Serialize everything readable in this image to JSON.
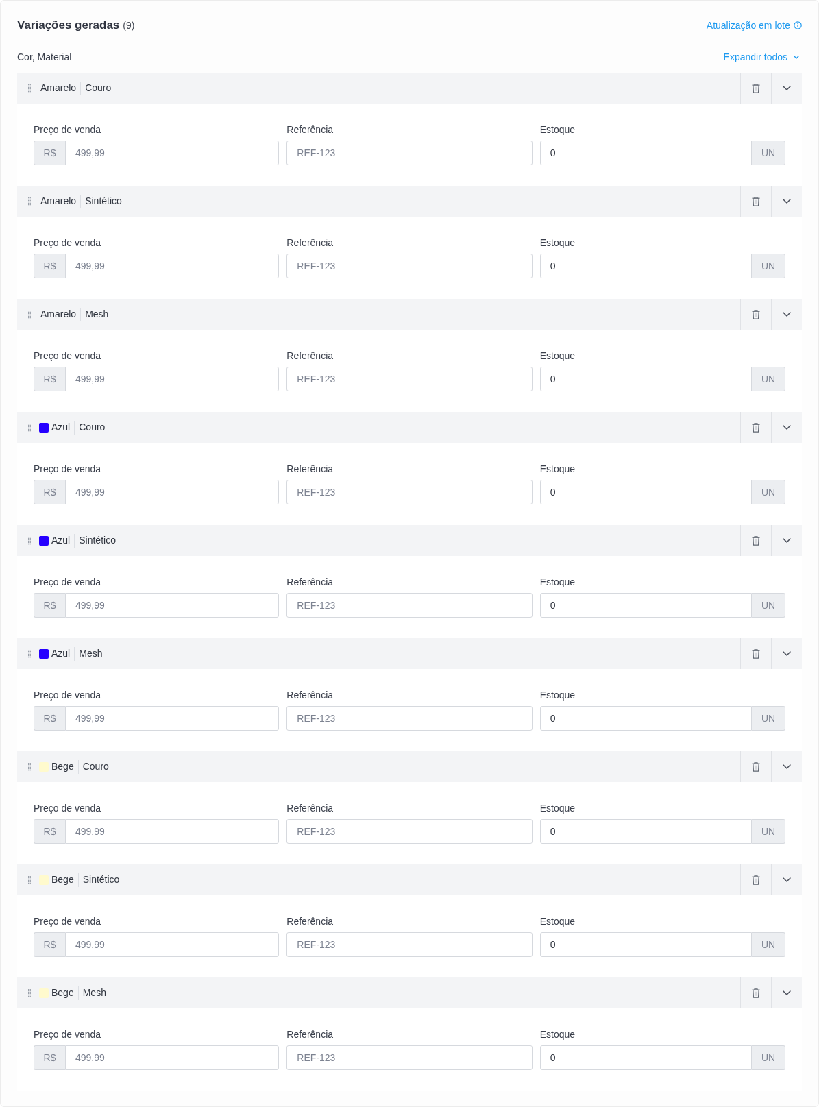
{
  "header": {
    "title": "Variações geradas",
    "count": "(9)",
    "bulk_update": "Atualização em lote"
  },
  "subheader": {
    "attributes": "Cor, Material",
    "expand_all": "Expandir todos"
  },
  "variations": [
    {
      "options": [
        "Amarelo",
        "Couro"
      ],
      "expanded": true,
      "fields": [
        {
          "label": "Preço de venda",
          "prefix": "R$",
          "placeholder": "499,99"
        },
        {
          "label": "Referência",
          "placeholder": "REF-123"
        },
        {
          "label": "Estoque",
          "value": "0",
          "suffix": "UN"
        }
      ]
    },
    {
      "options": [
        "Amarelo",
        "Sintético"
      ],
      "expanded": true,
      "fields": [
        {
          "label": "Preço de venda",
          "prefix": "R$",
          "placeholder": "499,99"
        },
        {
          "label": "Referência",
          "placeholder": "REF-123"
        },
        {
          "label": "Estoque",
          "value": "0",
          "suffix": "UN"
        }
      ]
    },
    {
      "options": [
        "Amarelo",
        "Mesh"
      ],
      "expanded": true,
      "fields": [
        {
          "label": "Preço de venda",
          "prefix": "R$",
          "placeholder": "499,99"
        },
        {
          "label": "Referência",
          "placeholder": "REF-123"
        },
        {
          "label": "Estoque",
          "value": "0",
          "suffix": "UN"
        }
      ]
    },
    {
      "options": [
        "Azul",
        "Couro"
      ],
      "color": "#2600ff",
      "expanded": true,
      "fields": [
        {
          "label": "Preço de venda",
          "prefix": "R$",
          "placeholder": "499,99"
        },
        {
          "label": "Referência",
          "placeholder": "REF-123"
        },
        {
          "label": "Estoque",
          "value": "0",
          "suffix": "UN"
        }
      ]
    },
    {
      "options": [
        "Azul",
        "Sintético"
      ],
      "color": "#2600ff",
      "expanded": true,
      "fields": [
        {
          "label": "Preço de venda",
          "prefix": "R$",
          "placeholder": "499,99"
        },
        {
          "label": "Referência",
          "placeholder": "REF-123"
        },
        {
          "label": "Estoque",
          "value": "0",
          "suffix": "UN"
        }
      ]
    },
    {
      "options": [
        "Azul",
        "Mesh"
      ],
      "color": "#2600ff",
      "expanded": true,
      "fields": [
        {
          "label": "Preço de venda",
          "prefix": "R$",
          "placeholder": "499,99"
        },
        {
          "label": "Referência",
          "placeholder": "REF-123"
        },
        {
          "label": "Estoque",
          "value": "0",
          "suffix": "UN"
        }
      ]
    },
    {
      "options": [
        "Bege",
        "Couro"
      ],
      "color": "#fffacd",
      "expanded": true,
      "fields": [
        {
          "label": "Preço de venda",
          "prefix": "R$",
          "placeholder": "499,99"
        },
        {
          "label": "Referência",
          "placeholder": "REF-123"
        },
        {
          "label": "Estoque",
          "value": "0",
          "suffix": "UN"
        }
      ]
    },
    {
      "options": [
        "Bege",
        "Sintético"
      ],
      "color": "#fffacd",
      "expanded": true,
      "fields": [
        {
          "label": "Preço de venda",
          "prefix": "R$",
          "placeholder": "499,99"
        },
        {
          "label": "Referência",
          "placeholder": "REF-123"
        },
        {
          "label": "Estoque",
          "value": "0",
          "suffix": "UN"
        }
      ]
    },
    {
      "options": [
        "Bege",
        "Mesh"
      ],
      "color": "#fffacd",
      "expanded": true,
      "fields": [
        {
          "label": "Preço de venda",
          "prefix": "R$",
          "placeholder": "499,99"
        },
        {
          "label": "Referência",
          "placeholder": "REF-123"
        },
        {
          "label": "Estoque",
          "value": "0",
          "suffix": "UN"
        }
      ]
    }
  ]
}
